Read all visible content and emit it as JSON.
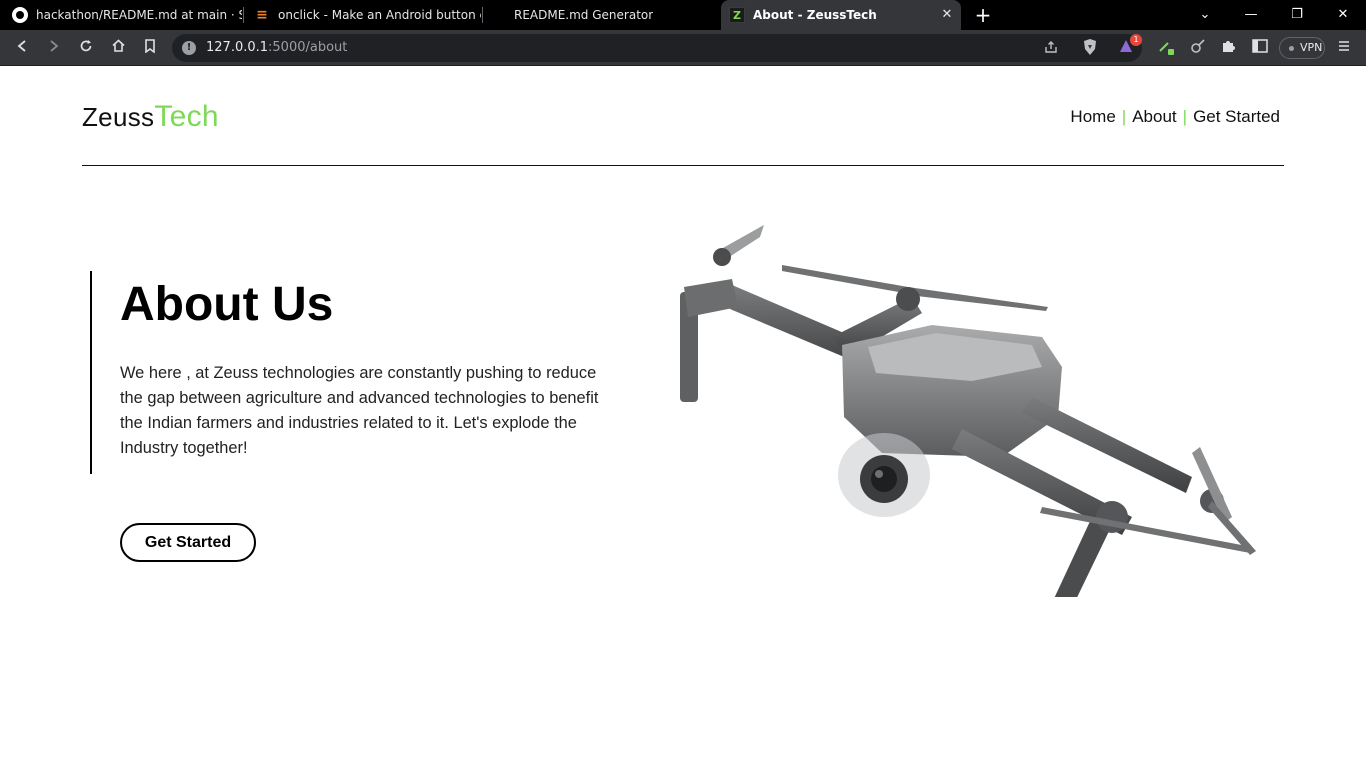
{
  "browser": {
    "tabs": [
      {
        "title": "hackathon/README.md at main · Saw",
        "icon": "github-icon"
      },
      {
        "title": "onclick - Make an Android button cha",
        "icon": "stackoverflow-icon"
      },
      {
        "title": "README.md Generator",
        "icon": ""
      },
      {
        "title": "About - ZeussTech",
        "icon": "zeusstech-favicon",
        "favicon_letter": "Z",
        "active": true
      }
    ],
    "new_tab": "+",
    "window_controls": {
      "dropdown": "⌄",
      "minimize": "—",
      "restore": "❐",
      "close": "✕"
    },
    "tab_close": "✕",
    "address": {
      "host": "127.0.0.1",
      "path": ":5000/about"
    },
    "shield_badge": "1",
    "vpn_label": "VPN"
  },
  "site": {
    "brand": {
      "primary": "Zeuss",
      "accent": "Tech"
    },
    "nav": [
      {
        "label": "Home"
      },
      {
        "label": "About"
      },
      {
        "label": "Get Started"
      }
    ],
    "nav_separator": "|",
    "accent_color": "#7ed957"
  },
  "about": {
    "title": "About Us",
    "text": "We here , at Zeuss technologies are constantly pushing to reduce the gap between agriculture and advanced technologies to benefit the Indian farmers and industries related to it. Let's explode the Industry together!",
    "cta": "Get Started"
  }
}
